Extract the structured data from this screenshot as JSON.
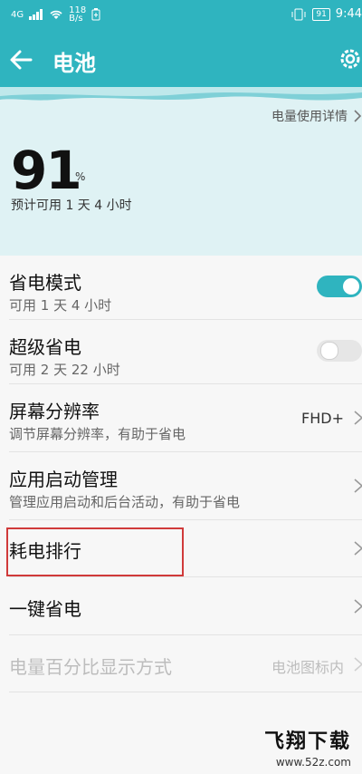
{
  "status_bar": {
    "network": "4G",
    "speed_value": "118",
    "speed_unit": "B/s",
    "battery_level": "91",
    "time": "9:44"
  },
  "app_bar": {
    "title": "电池"
  },
  "summary": {
    "usage_details_link": "电量使用详情",
    "battery_percent": "91",
    "percent_unit": "%",
    "estimated_time": "预计可用 1 天 4 小时"
  },
  "list": {
    "power_saving": {
      "title": "省电模式",
      "subtitle": "可用 1 天 4 小时",
      "enabled": true
    },
    "ultra_power_saving": {
      "title": "超级省电",
      "subtitle": "可用 2 天 22 小时",
      "enabled": false
    },
    "screen_resolution": {
      "title": "屏幕分辨率",
      "subtitle": "调节屏幕分辨率，有助于省电",
      "value": "FHD+"
    },
    "app_launch": {
      "title": "应用启动管理",
      "subtitle": "管理应用启动和后台活动，有助于省电"
    },
    "consumption_ranking": {
      "title": "耗电排行"
    },
    "one_key_saving": {
      "title": "一键省电"
    },
    "battery_percentage_display": {
      "title": "电量百分比显示方式",
      "value": "电池图标内"
    }
  },
  "watermark": {
    "brand": "飞翔下载",
    "url": "www.52z.com"
  },
  "colors": {
    "accent": "#2fb4bf",
    "summary_bg": "#dff2f4",
    "highlight": "#d03a3a"
  }
}
